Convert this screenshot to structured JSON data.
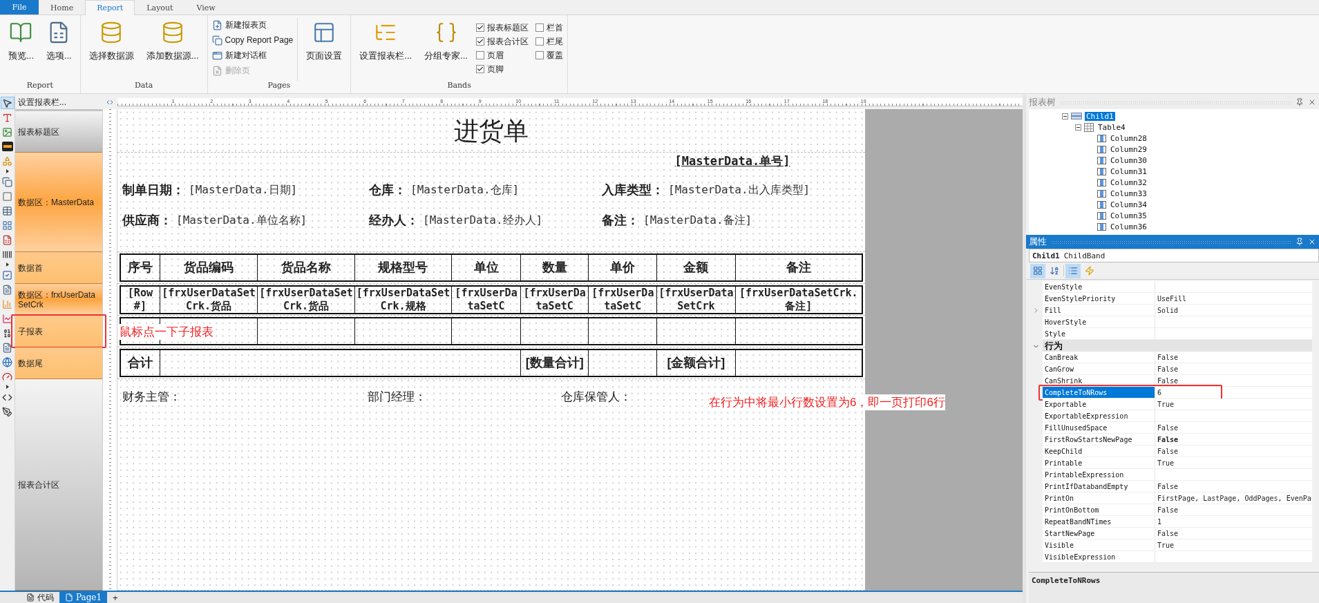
{
  "ribbon": {
    "file_tab": "File",
    "tabs": [
      {
        "label": "Home",
        "selected": false
      },
      {
        "label": "Report",
        "selected": true
      },
      {
        "label": "Layout",
        "selected": false
      },
      {
        "label": "View",
        "selected": false
      }
    ],
    "groups": [
      {
        "label": "Report",
        "items": [
          {
            "kind": "large",
            "label": "预览..."
          },
          {
            "kind": "large",
            "label": "选项..."
          }
        ]
      },
      {
        "label": "Data",
        "items": [
          {
            "kind": "large",
            "label": "选择数据源"
          },
          {
            "kind": "large",
            "label": "添加数据源..."
          }
        ]
      },
      {
        "label": "Pages",
        "items": [
          {
            "kind": "small",
            "label": "新建报表页",
            "disabled": false
          },
          {
            "kind": "small",
            "label": "Copy Report Page",
            "disabled": false
          },
          {
            "kind": "small",
            "label": "新建对话框",
            "disabled": false
          },
          {
            "kind": "small",
            "label": "删除页",
            "disabled": true
          },
          {
            "kind": "large",
            "label": "页面设置"
          }
        ]
      },
      {
        "label": "Bands",
        "items": [
          {
            "kind": "large",
            "label": "设置报表栏..."
          },
          {
            "kind": "large",
            "label": "分组专家..."
          },
          {
            "kind": "check",
            "label": "报表标题区",
            "checked": true
          },
          {
            "kind": "check",
            "label": "报表合计区",
            "checked": true
          },
          {
            "kind": "check",
            "label": "页眉",
            "checked": false
          },
          {
            "kind": "check",
            "label": "页脚",
            "checked": true
          },
          {
            "kind": "check",
            "label": "栏首",
            "checked": false
          },
          {
            "kind": "check",
            "label": "栏尾",
            "checked": false
          },
          {
            "kind": "check",
            "label": "覆盖",
            "checked": false
          }
        ]
      }
    ]
  },
  "toolbox": [
    {
      "selected": true
    },
    {
      "selected": false
    },
    {
      "selected": false
    },
    {
      "selected": false
    },
    {
      "selected": false
    },
    {
      "selected": false
    },
    {
      "selected": false
    },
    {
      "selected": false
    },
    {
      "selected": false
    },
    {
      "selected": false
    },
    {
      "selected": false
    },
    {
      "selected": false
    },
    {
      "selected": false
    },
    {
      "selected": false
    },
    {
      "selected": false
    },
    {
      "selected": false
    },
    {
      "selected": false
    },
    {
      "selected": false
    },
    {
      "selected": false
    },
    {
      "selected": false
    },
    {
      "selected": false
    }
  ],
  "bands_header": "设置报表栏...",
  "ruler": [
    "1",
    "2",
    "3",
    "4",
    "5",
    "6",
    "7",
    "8",
    "9",
    "10",
    "11",
    "12",
    "13",
    "14",
    "15",
    "16",
    "17",
    "18",
    "19"
  ],
  "bands": [
    {
      "kind": "title",
      "label": "报表标题区",
      "annotated": false
    },
    {
      "kind": "master",
      "label": "数据区：MasterData",
      "annotated": false
    },
    {
      "kind": "header",
      "label": "数据首",
      "annotated": false
    },
    {
      "kind": "data",
      "label": "数据区：frxUserDataSetCrk",
      "annotated": false
    },
    {
      "kind": "child",
      "label": "子报表",
      "annotated": true
    },
    {
      "kind": "footer",
      "label": "数据尾",
      "annotated": false
    },
    {
      "kind": "summary",
      "label": "报表合计区",
      "annotated": false
    }
  ],
  "report": {
    "title": "进货单",
    "order_no": "[MasterData.单号]",
    "fields": [
      {
        "label": "制单日期：",
        "value": "[MasterData.日期]"
      },
      {
        "label": "仓库：",
        "value": "[MasterData.仓库]"
      },
      {
        "label": "入库类型：",
        "value": "[MasterData.出入库类型]"
      },
      {
        "label": "供应商：",
        "value": "[MasterData.单位名称]"
      },
      {
        "label": "经办人：",
        "value": "[MasterData.经办人]"
      },
      {
        "label": "备注：",
        "value": "[MasterData.备注]"
      }
    ],
    "columns": [
      "序号",
      "货品编码",
      "货品名称",
      "规格型号",
      "单位",
      "数量",
      "单价",
      "金额",
      "备注"
    ],
    "data_row": [
      "[Row#]",
      "[frxUserDataSetCrk.货品",
      "[frxUserDataSetCrk.货品",
      "[frxUserDataSetCrk.规格",
      "[frxUserDataSetC",
      "[frxUserDataSetC",
      "[frxUserDataSetC",
      "[frxUserDataSetCrk",
      "[frxUserDataSetCrk.备注]"
    ],
    "child_note": "鼠标点一下子报表",
    "footer": {
      "label": "合计",
      "quantity_total": "[数量合计]",
      "amount_total": "[金额合计]"
    },
    "signatures": [
      "财务主管：",
      "部门经理：",
      "仓库保管人："
    ],
    "properties_note": "在行为中将最小行数设置为6，即一页打印6行"
  },
  "bottom_tabs": [
    {
      "label": "代码",
      "selected": false
    },
    {
      "label": "Page1",
      "selected": true
    }
  ],
  "bottom_add": "+",
  "tree": {
    "title": "报表树",
    "nodes": [
      {
        "kind": "band",
        "label": "Child1",
        "selected": true,
        "expanded": true,
        "children": [
          {
            "kind": "table",
            "label": "Table4",
            "selected": false,
            "expanded": true,
            "children": [
              {
                "kind": "column",
                "label": "Column28",
                "selected": false
              },
              {
                "kind": "column",
                "label": "Column29",
                "selected": false
              },
              {
                "kind": "column",
                "label": "Column30",
                "selected": false
              },
              {
                "kind": "column",
                "label": "Column31",
                "selected": false
              },
              {
                "kind": "column",
                "label": "Column32",
                "selected": false
              },
              {
                "kind": "column",
                "label": "Column33",
                "selected": false
              },
              {
                "kind": "column",
                "label": "Column34",
                "selected": false
              },
              {
                "kind": "column",
                "label": "Column35",
                "selected": false
              },
              {
                "kind": "column",
                "label": "Column36",
                "selected": false
              }
            ]
          }
        ]
      }
    ]
  },
  "properties": {
    "title": "属性",
    "object_name": "Child1",
    "object_type": "ChildBand",
    "toolbar": [
      {
        "selected": true
      },
      {
        "selected": false
      },
      {
        "selected": true
      },
      {
        "selected": false
      }
    ],
    "rows": [
      {
        "kind": "prop",
        "name": "EvenStyle",
        "selected": false,
        "annotated": false
      },
      {
        "kind": "prop",
        "name": "EvenStylePriority",
        "value": "UseFill",
        "selected": false,
        "modified": false,
        "annotated": false
      },
      {
        "kind": "expandable",
        "name": "Fill",
        "value": "Solid",
        "selected": false,
        "modified": false,
        "annotated": false
      },
      {
        "kind": "prop",
        "name": "HoverStyle",
        "selected": false,
        "annotated": false
      },
      {
        "kind": "prop",
        "name": "Style",
        "selected": false,
        "annotated": false
      },
      {
        "kind": "category",
        "name": "行为",
        "expanded": true,
        "selected": false,
        "annotated": false
      },
      {
        "kind": "prop",
        "name": "CanBreak",
        "value": "False",
        "selected": false,
        "modified": false,
        "annotated": false
      },
      {
        "kind": "prop",
        "name": "CanGrow",
        "value": "False",
        "selected": false,
        "modified": false,
        "annotated": false
      },
      {
        "kind": "prop",
        "name": "CanShrink",
        "value": "False",
        "selected": false,
        "modified": false,
        "annotated": false
      },
      {
        "kind": "prop",
        "name": "CompleteToNRows",
        "value": "6",
        "selected": true,
        "modified": false,
        "annotated": true
      },
      {
        "kind": "prop",
        "name": "Exportable",
        "value": "True",
        "selected": false,
        "modified": false,
        "annotated": false
      },
      {
        "kind": "prop",
        "name": "ExportableExpression",
        "selected": false,
        "annotated": false
      },
      {
        "kind": "prop",
        "name": "FillUnusedSpace",
        "value": "False",
        "selected": false,
        "modified": false,
        "annotated": false
      },
      {
        "kind": "prop",
        "name": "FirstRowStartsNewPage",
        "value": "False",
        "selected": false,
        "modified": true,
        "annotated": false
      },
      {
        "kind": "prop",
        "name": "KeepChild",
        "value": "False",
        "selected": false,
        "modified": false,
        "annotated": false
      },
      {
        "kind": "prop",
        "name": "Printable",
        "value": "True",
        "selected": false,
        "modified": false,
        "annotated": false
      },
      {
        "kind": "prop",
        "name": "PrintableExpression",
        "selected": false,
        "annotated": false
      },
      {
        "kind": "prop",
        "name": "PrintIfDatabandEmpty",
        "value": "False",
        "selected": false,
        "modified": false,
        "annotated": false
      },
      {
        "kind": "prop",
        "name": "PrintOn",
        "value": "FirstPage, LastPage, OddPages, EvenPa",
        "selected": false,
        "modified": false,
        "annotated": false
      },
      {
        "kind": "prop",
        "name": "PrintOnBottom",
        "value": "False",
        "selected": false,
        "modified": false,
        "annotated": false
      },
      {
        "kind": "prop",
        "name": "RepeatBandNTimes",
        "value": "1",
        "selected": false,
        "modified": false,
        "annotated": false
      },
      {
        "kind": "prop",
        "name": "StartNewPage",
        "value": "False",
        "selected": false,
        "modified": false,
        "annotated": false
      },
      {
        "kind": "prop",
        "name": "Visible",
        "value": "True",
        "selected": false,
        "modified": false,
        "annotated": false
      },
      {
        "kind": "prop",
        "name": "VisibleExpression",
        "selected": false,
        "annotated": false
      }
    ],
    "description": "CompleteToNRows"
  }
}
